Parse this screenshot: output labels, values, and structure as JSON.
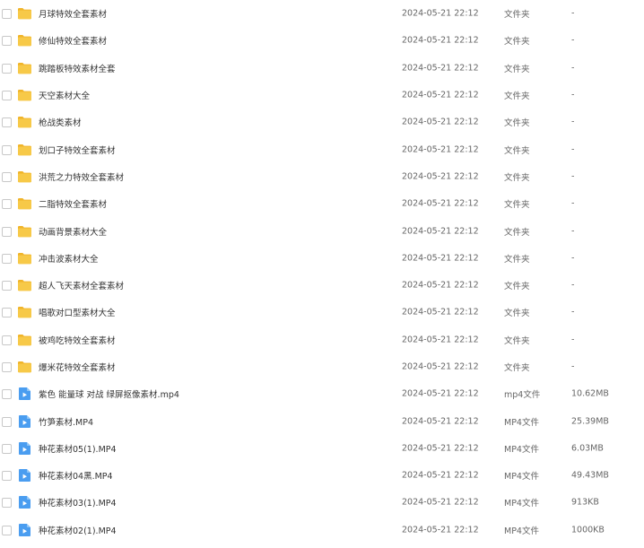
{
  "colors": {
    "folder": "#F7C948",
    "folder_tab": "#F0B429",
    "video": "#4A9DF0",
    "checkbox_border": "#c8c8c8",
    "text_primary": "#333333",
    "text_secondary": "#666666"
  },
  "rows": [
    {
      "name": "月球特效全套素材",
      "date": "2024-05-21 22:12",
      "type": "文件夹",
      "size": "-",
      "icon": "folder-icon"
    },
    {
      "name": "修仙特效全套素材",
      "date": "2024-05-21 22:12",
      "type": "文件夹",
      "size": "-",
      "icon": "folder-icon"
    },
    {
      "name": "跳踏板特效素材全套",
      "date": "2024-05-21 22:12",
      "type": "文件夹",
      "size": "-",
      "icon": "folder-icon"
    },
    {
      "name": "天空素材大全",
      "date": "2024-05-21 22:12",
      "type": "文件夹",
      "size": "-",
      "icon": "folder-icon"
    },
    {
      "name": "枪战类素材",
      "date": "2024-05-21 22:12",
      "type": "文件夹",
      "size": "-",
      "icon": "folder-icon"
    },
    {
      "name": "划口子特效全套素材",
      "date": "2024-05-21 22:12",
      "type": "文件夹",
      "size": "-",
      "icon": "folder-icon"
    },
    {
      "name": "洪荒之力特效全套素材",
      "date": "2024-05-21 22:12",
      "type": "文件夹",
      "size": "-",
      "icon": "folder-icon"
    },
    {
      "name": "二脂特效全套素材",
      "date": "2024-05-21 22:12",
      "type": "文件夹",
      "size": "-",
      "icon": "folder-icon"
    },
    {
      "name": "动画背景素材大全",
      "date": "2024-05-21 22:12",
      "type": "文件夹",
      "size": "-",
      "icon": "folder-icon"
    },
    {
      "name": "冲击波素材大全",
      "date": "2024-05-21 22:12",
      "type": "文件夹",
      "size": "-",
      "icon": "folder-icon"
    },
    {
      "name": "超人飞天素材全套素材",
      "date": "2024-05-21 22:12",
      "type": "文件夹",
      "size": "-",
      "icon": "folder-icon"
    },
    {
      "name": "唱歌对口型素材大全",
      "date": "2024-05-21 22:12",
      "type": "文件夹",
      "size": "-",
      "icon": "folder-icon"
    },
    {
      "name": "被鸡吃特效全套素材",
      "date": "2024-05-21 22:12",
      "type": "文件夹",
      "size": "-",
      "icon": "folder-icon"
    },
    {
      "name": "爆米花特效全套素材",
      "date": "2024-05-21 22:12",
      "type": "文件夹",
      "size": "-",
      "icon": "folder-icon"
    },
    {
      "name": "紫色 能量球 对战 绿屏抠像素材.mp4",
      "date": "2024-05-21 22:12",
      "type": "mp4文件",
      "size": "10.62MB",
      "icon": "video-file-icon"
    },
    {
      "name": "竹笋素材.MP4",
      "date": "2024-05-21 22:12",
      "type": "MP4文件",
      "size": "25.39MB",
      "icon": "video-file-icon"
    },
    {
      "name": "种花素材05(1).MP4",
      "date": "2024-05-21 22:12",
      "type": "MP4文件",
      "size": "6.03MB",
      "icon": "video-file-icon"
    },
    {
      "name": "种花素材04黑.MP4",
      "date": "2024-05-21 22:12",
      "type": "MP4文件",
      "size": "49.43MB",
      "icon": "video-file-icon"
    },
    {
      "name": "种花素材03(1).MP4",
      "date": "2024-05-21 22:12",
      "type": "MP4文件",
      "size": "913KB",
      "icon": "video-file-icon"
    },
    {
      "name": "种花素材02(1).MP4",
      "date": "2024-05-21 22:12",
      "type": "MP4文件",
      "size": "1000KB",
      "icon": "video-file-icon"
    }
  ]
}
